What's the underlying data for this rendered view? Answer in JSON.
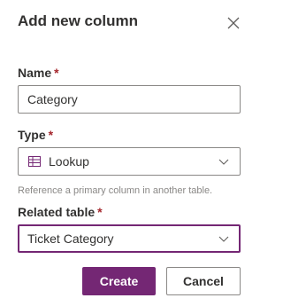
{
  "dialog": {
    "title": "Add new column",
    "close_icon": "close-icon"
  },
  "fields": {
    "name": {
      "label": "Name",
      "required_mark": "*",
      "value": "Category"
    },
    "type": {
      "label": "Type",
      "required_mark": "*",
      "value": "Lookup",
      "icon": "lookup-icon",
      "helper_text": "Reference a primary column in another table."
    },
    "related_table": {
      "label": "Related table",
      "required_mark": "*",
      "value": "Ticket Category"
    }
  },
  "actions": {
    "create_label": "Create",
    "cancel_label": "Cancel"
  },
  "colors": {
    "accent": "#742774",
    "required": "#a4262c",
    "border": "#8a8886",
    "text": "#323130",
    "helper": "#8a8886"
  }
}
